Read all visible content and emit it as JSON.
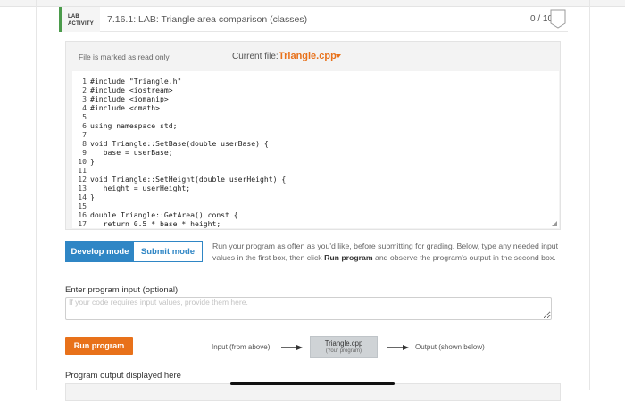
{
  "header": {
    "badge_line1": "LAB",
    "badge_line2": "ACTIVITY",
    "title": "7.16.1: LAB: Triangle area comparison (classes)",
    "score": "0 / 10"
  },
  "editor": {
    "readonly_notice": "File is marked as read only",
    "current_file_label": "Current file:",
    "current_file": "Triangle.cpp",
    "lines": [
      {
        "n": "1",
        "code": "#include \"Triangle.h\""
      },
      {
        "n": "2",
        "code": "#include <iostream>"
      },
      {
        "n": "3",
        "code": "#include <iomanip>"
      },
      {
        "n": "4",
        "code": "#include <cmath>"
      },
      {
        "n": "5",
        "code": ""
      },
      {
        "n": "6",
        "code": "using namespace std;"
      },
      {
        "n": "7",
        "code": ""
      },
      {
        "n": "8",
        "code": "void Triangle::SetBase(double userBase) {"
      },
      {
        "n": "9",
        "code": "   base = userBase;"
      },
      {
        "n": "10",
        "code": "}"
      },
      {
        "n": "11",
        "code": ""
      },
      {
        "n": "12",
        "code": "void Triangle::SetHeight(double userHeight) {"
      },
      {
        "n": "13",
        "code": "   height = userHeight;"
      },
      {
        "n": "14",
        "code": "}"
      },
      {
        "n": "15",
        "code": ""
      },
      {
        "n": "16",
        "code": "double Triangle::GetArea() const {"
      },
      {
        "n": "17",
        "code": "   return 0.5 * base * height;"
      }
    ]
  },
  "modes": {
    "develop": "Develop mode",
    "submit": "Submit mode"
  },
  "instructions": {
    "before": "Run your program as often as you'd like, before submitting for grading. Below, type any needed input values in the first box, then click ",
    "bold": "Run program",
    "after": " and observe the program's output in the second box."
  },
  "input": {
    "label": "Enter program input (optional)",
    "placeholder": "If your code requires input values, provide them here."
  },
  "run": {
    "button": "Run program",
    "input_from": "Input (from above)",
    "file_name": "Triangle.cpp",
    "file_sub": "(Your program)",
    "output_to": "Output (shown below)"
  },
  "output": {
    "label": "Program output displayed here"
  },
  "colors": {
    "accent_orange": "#e8711a",
    "accent_blue": "#2f86c5",
    "lab_green": "#4b9b4b"
  }
}
